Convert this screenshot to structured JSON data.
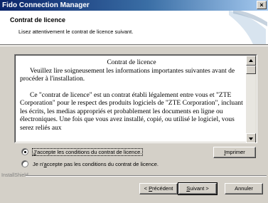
{
  "window": {
    "title": "Fido Connection Manager",
    "close_glyph": "×"
  },
  "header": {
    "title": "Contrat de licence",
    "subtitle": "Lisez attentivement le contrat de licence suivant."
  },
  "license": {
    "heading": "Contrat de licence",
    "para1": "Veuillez lire soigneusement les informations importantes suivantes avant de procéder à l'installation.",
    "para2": "Ce \"contrat de licence\" est un contrat établi légalement entre vous et \"ZTE Corporation\" pour le respect des produits logiciels de \"ZTE Corporation\", incluant les écrits, les medias appropriés et probablement les documents en ligne ou électroniques. Une fois que vous avez installé, copié, ou utilisé le logiciel, vous serez reliés aux"
  },
  "options": {
    "accept": {
      "pre": "",
      "key": "J",
      "post": "'accepte les conditions du contrat de licence.",
      "selected": true
    },
    "decline": {
      "pre": "Je n'",
      "key": "a",
      "post": "ccepte pas les conditions du contrat de licence.",
      "selected": false
    }
  },
  "buttons": {
    "print": {
      "key": "I",
      "rest": "mprimer"
    },
    "back": {
      "pre": "< ",
      "key": "P",
      "rest": "récédent"
    },
    "next": {
      "key": "S",
      "rest": "uivant >"
    },
    "cancel": "Annuler"
  },
  "footer": {
    "brand": "InstallShield"
  },
  "icons": [
    "close-icon",
    "scroll-up-arrow-icon",
    "scroll-down-arrow-icon",
    "header-swoosh-graphic"
  ]
}
